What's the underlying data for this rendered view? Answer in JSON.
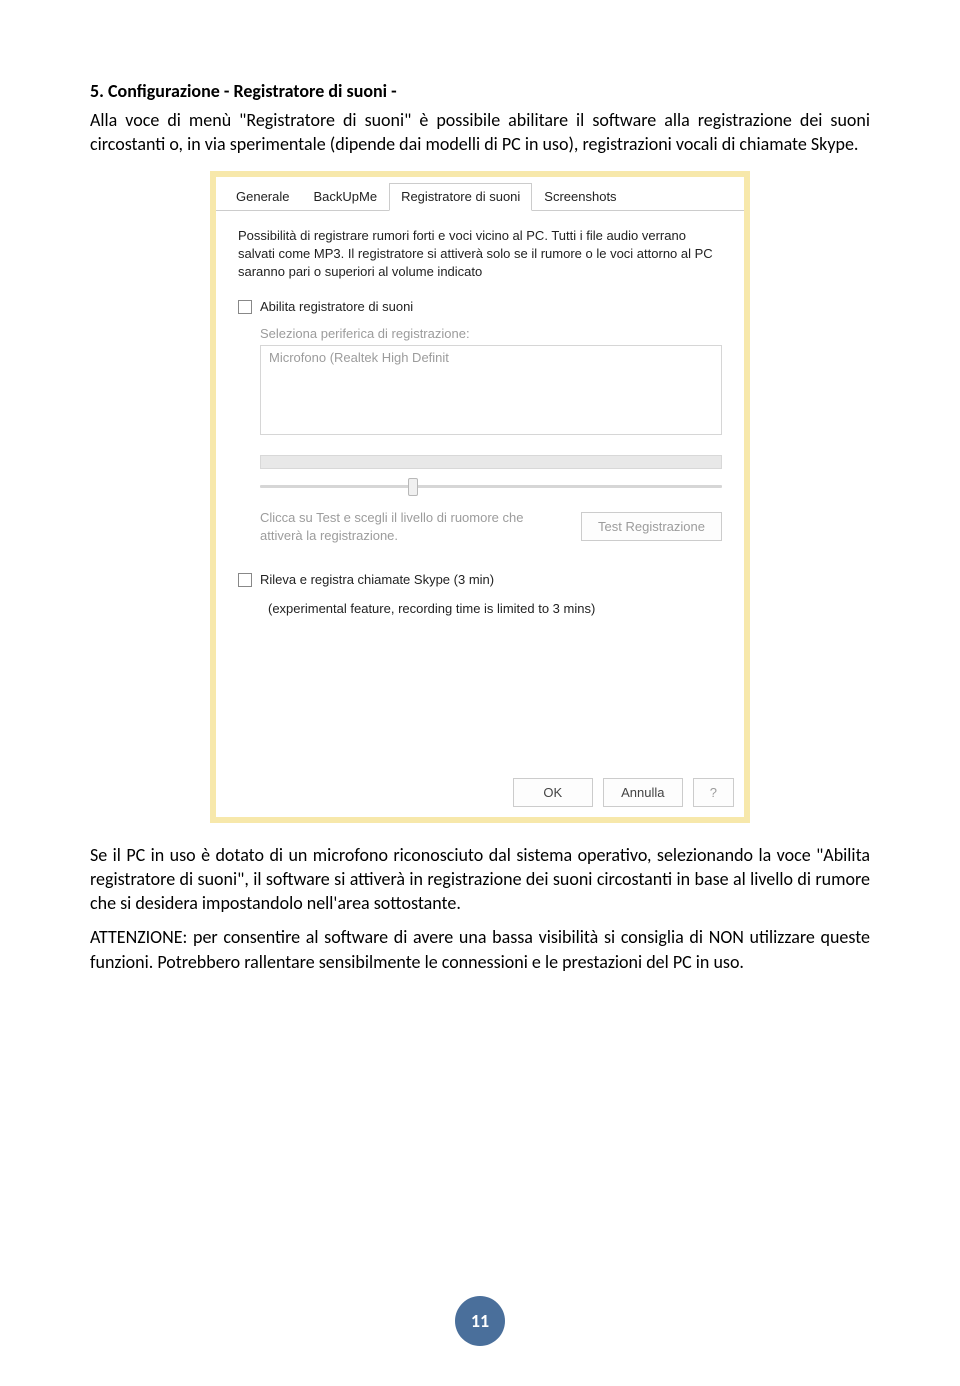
{
  "section": {
    "prefix": "5.",
    "title": "Configurazione - Registratore di suoni -",
    "para1": "Alla voce di menù \"Registratore di suoni\" è possibile abilitare il software alla registrazione dei suoni circostanti o, in via sperimentale (dipende dai modelli di PC in uso), registrazioni vocali di chiamate Skype.",
    "para2": "Se il PC in uso è dotato di un microfono riconosciuto dal sistema operativo, selezionando la voce \"Abilita registratore di suoni\", il software si attiverà in registrazione dei suoni circostanti in base al livello di rumore che si desidera impostandolo nell'area sottostante.",
    "para3": "ATTENZIONE: per consentire al software di avere una bassa visibilità si consiglia di NON utilizzare queste funzioni. Potrebbero rallentare sensibilmente le connessioni e le prestazioni del PC in uso."
  },
  "dialog": {
    "tabs": {
      "generale": "Generale",
      "backup": "BackUpMe",
      "registratore": "Registratore di suoni",
      "screenshots": "Screenshots"
    },
    "desc": "Possibilità di registrare rumori forti e voci vicino al PC. Tutti i file audio verrano salvati come MP3. Il registratore si attiverà solo se il rumore o le voci attorno al PC saranno pari o superiori al volume indicato",
    "enable_label": "Abilita registratore di suoni",
    "device_label": "Seleziona periferica di registrazione:",
    "device_value": "Microfono (Realtek High Definit",
    "test_hint": "Clicca su Test e scegli il livello di ruomore che attiverà la registrazione.",
    "test_button": "Test Registrazione",
    "skype_label": "Rileva e registra chiamate Skype (3 min)",
    "skype_note": "(experimental feature, recording time is limited to 3 mins)",
    "ok": "OK",
    "cancel": "Annulla",
    "help": "?"
  },
  "page_number": "11"
}
